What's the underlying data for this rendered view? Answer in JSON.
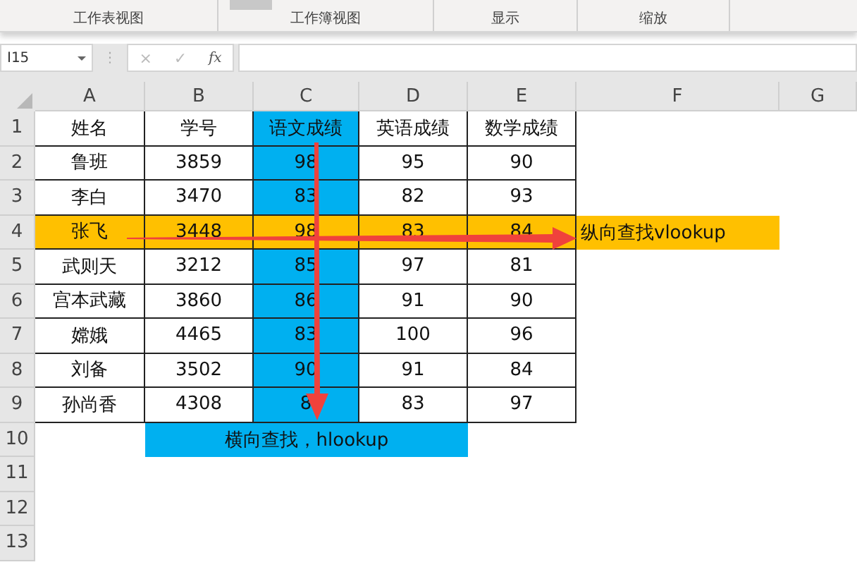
{
  "ribbon": {
    "groups": [
      {
        "label": "工作表视图"
      },
      {
        "label": "工作簿视图"
      },
      {
        "label": "显示"
      },
      {
        "label": "缩放"
      }
    ]
  },
  "formula_bar": {
    "name_box": "I15",
    "grip": "⋮",
    "cancel": "×",
    "enter": "✓",
    "function": "fx"
  },
  "columns": [
    "A",
    "B",
    "C",
    "D",
    "E",
    "F",
    "G"
  ],
  "rows": [
    {
      "number": "1",
      "cells": [
        {
          "text": "姓名"
        },
        {
          "text": "学号"
        },
        {
          "text": "语文成绩",
          "color": "#00b0f0"
        },
        {
          "text": "英语成绩"
        },
        {
          "text": "数学成绩"
        }
      ]
    },
    {
      "number": "2",
      "cells": [
        {
          "text": "鲁班"
        },
        {
          "text": "3859"
        },
        {
          "text": "98",
          "color": "#00b0f0"
        },
        {
          "text": "95"
        },
        {
          "text": "90"
        }
      ]
    },
    {
      "number": "3",
      "cells": [
        {
          "text": "李白"
        },
        {
          "text": "3470"
        },
        {
          "text": "83",
          "color": "#00b0f0"
        },
        {
          "text": "82"
        },
        {
          "text": "93"
        }
      ]
    },
    {
      "number": "4",
      "cells": [
        {
          "text": "张飞",
          "color": "#ffc000"
        },
        {
          "text": "3448",
          "color": "#ffc000"
        },
        {
          "text": "98",
          "color": "#ffc000"
        },
        {
          "text": "83",
          "color": "#ffc000"
        },
        {
          "text": "84",
          "color": "#ffc000"
        }
      ],
      "note": {
        "text": "纵向查找vlookup",
        "color": "#ffc000"
      }
    },
    {
      "number": "5",
      "cells": [
        {
          "text": "武则天"
        },
        {
          "text": "3212"
        },
        {
          "text": "85",
          "color": "#00b0f0"
        },
        {
          "text": "97"
        },
        {
          "text": "81"
        }
      ]
    },
    {
      "number": "6",
      "cells": [
        {
          "text": "宫本武藏"
        },
        {
          "text": "3860"
        },
        {
          "text": "86",
          "color": "#00b0f0"
        },
        {
          "text": "91"
        },
        {
          "text": "90"
        }
      ]
    },
    {
      "number": "7",
      "cells": [
        {
          "text": "嫦娥"
        },
        {
          "text": "4465"
        },
        {
          "text": "83",
          "color": "#00b0f0"
        },
        {
          "text": "100"
        },
        {
          "text": "96"
        }
      ]
    },
    {
      "number": "8",
      "cells": [
        {
          "text": "刘备"
        },
        {
          "text": "3502"
        },
        {
          "text": "90",
          "color": "#00b0f0"
        },
        {
          "text": "91"
        },
        {
          "text": "84"
        }
      ]
    },
    {
      "number": "9",
      "cells": [
        {
          "text": "孙尚香"
        },
        {
          "text": "4308"
        },
        {
          "text": "8",
          "color": "#00b0f0"
        },
        {
          "text": "83"
        },
        {
          "text": "97"
        }
      ]
    },
    {
      "number": "10",
      "note": {
        "text": "横向查找，hlookup",
        "color": "#00b0f0"
      }
    },
    {
      "number": "11"
    },
    {
      "number": "12"
    },
    {
      "number": "13"
    }
  ]
}
